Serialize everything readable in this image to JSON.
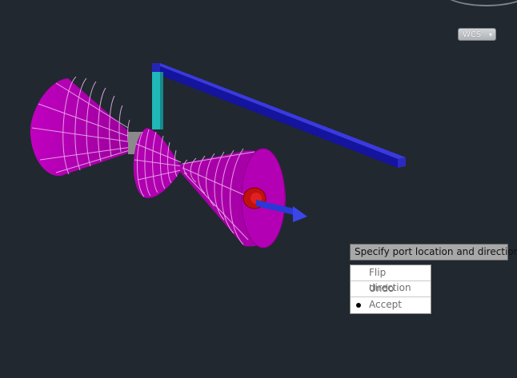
{
  "ucs": {
    "label": "WCS",
    "chevron": "▾"
  },
  "prompt": {
    "text": "Specify port location and direction"
  },
  "menu": {
    "items": [
      {
        "label": "Flip direction",
        "selected": false
      },
      {
        "label": "Undo",
        "selected": false
      },
      {
        "label": "Accept",
        "selected": true
      }
    ]
  },
  "colors": {
    "background": "#212830",
    "cone": "#b300b3",
    "mesh": "#f0c6f0",
    "beam": "#1a1aa6",
    "support": "#20b0b0",
    "port": "#c81010",
    "arrow": "#2e3ad0"
  }
}
